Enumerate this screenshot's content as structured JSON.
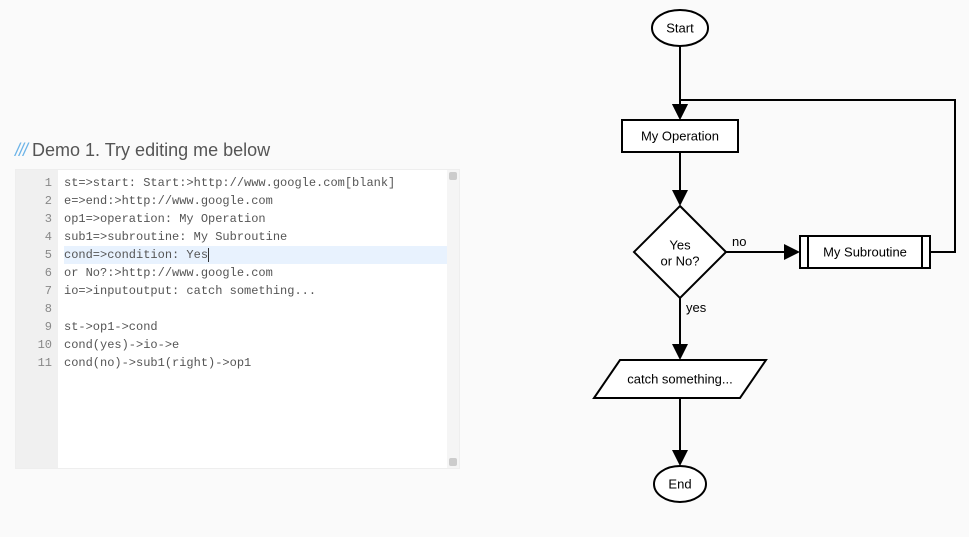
{
  "header": {
    "slashes": "///",
    "title": "Demo 1. Try editing me below"
  },
  "editor": {
    "active_line": 5,
    "lines": [
      "st=>start: Start:>http://www.google.com[blank]",
      "e=>end:>http://www.google.com",
      "op1=>operation: My Operation",
      "sub1=>subroutine: My Subroutine",
      "cond=>condition: Yes",
      "or No?:>http://www.google.com",
      "io=>inputoutput: catch something...",
      "",
      "st->op1->cond",
      "cond(yes)->io->e",
      "cond(no)->sub1(right)->op1"
    ]
  },
  "flowchart": {
    "nodes": {
      "start": {
        "label": "Start"
      },
      "operation": {
        "label": "My Operation"
      },
      "condition": {
        "line1": "Yes",
        "line2": "or No?"
      },
      "subroutine": {
        "label": "My Subroutine"
      },
      "io": {
        "label": "catch something..."
      },
      "end": {
        "label": "End"
      }
    },
    "edges": {
      "yes": "yes",
      "no": "no"
    }
  },
  "chart_data": {
    "type": "flowchart",
    "nodes": [
      {
        "id": "st",
        "type": "start",
        "label": "Start",
        "link": "http://www.google.com",
        "target": "blank"
      },
      {
        "id": "e",
        "type": "end",
        "label": "End",
        "link": "http://www.google.com"
      },
      {
        "id": "op1",
        "type": "operation",
        "label": "My Operation"
      },
      {
        "id": "sub1",
        "type": "subroutine",
        "label": "My Subroutine"
      },
      {
        "id": "cond",
        "type": "condition",
        "label": "Yes or No?",
        "link": "http://www.google.com"
      },
      {
        "id": "io",
        "type": "inputoutput",
        "label": "catch something..."
      }
    ],
    "edges": [
      {
        "from": "st",
        "to": "op1"
      },
      {
        "from": "op1",
        "to": "cond"
      },
      {
        "from": "cond",
        "to": "io",
        "branch": "yes"
      },
      {
        "from": "io",
        "to": "e"
      },
      {
        "from": "cond",
        "to": "sub1",
        "branch": "no",
        "direction": "right"
      },
      {
        "from": "sub1",
        "to": "op1",
        "direction": "right"
      }
    ]
  }
}
